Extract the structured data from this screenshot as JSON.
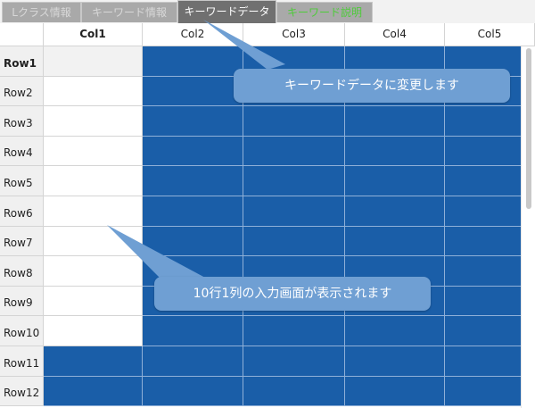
{
  "tabs": [
    {
      "label": "Lクラス情報",
      "state": "inactive"
    },
    {
      "label": "キーワード情報",
      "state": "inactive"
    },
    {
      "label": "キーワードデータ",
      "state": "active"
    },
    {
      "label": "キーワード説明",
      "state": "green"
    }
  ],
  "grid": {
    "columns": [
      "Col1",
      "Col2",
      "Col3",
      "Col4",
      "Col5"
    ],
    "rows": [
      "Row1",
      "Row2",
      "Row3",
      "Row4",
      "Row5",
      "Row6",
      "Row7",
      "Row8",
      "Row9",
      "Row10",
      "Row11",
      "Row12"
    ],
    "selected_color": "#1a5ea8"
  },
  "callouts": {
    "tab_note": "キーワードデータに変更します",
    "grid_note": "10行1列の入力画面が表示されます"
  }
}
